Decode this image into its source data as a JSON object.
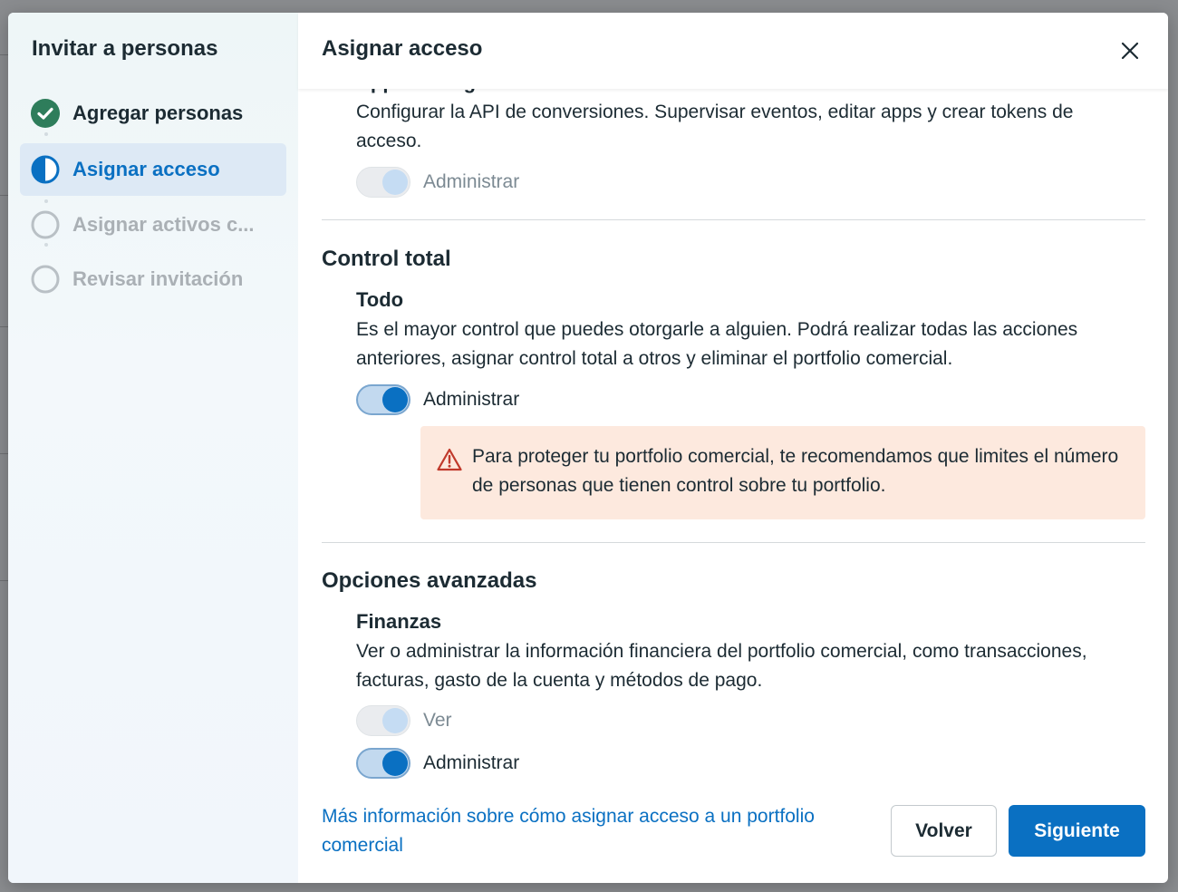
{
  "wizard": {
    "title": "Invitar a personas",
    "steps": [
      {
        "label": "Agregar personas",
        "state": "done"
      },
      {
        "label": "Asignar acceso",
        "state": "current"
      },
      {
        "label": "Asignar activos c...",
        "state": "todo"
      },
      {
        "label": "Revisar invitación",
        "state": "todo"
      }
    ]
  },
  "dialog": {
    "title": "Asignar acceso",
    "close_icon": "close-icon"
  },
  "apps_section": {
    "subtitle_clipped": "Apps e integraciones",
    "description": "Configurar la API de conversiones. Supervisar eventos, editar apps y crear tokens de acceso.",
    "toggles": [
      {
        "label": "Administrar",
        "state": "on-disabled"
      }
    ]
  },
  "full_control": {
    "section_title": "Control total",
    "subtitle": "Todo",
    "description": "Es el mayor control que puedes otorgarle a alguien. Podrá realizar todas las acciones anteriores, asignar control total a otros y eliminar el portfolio comercial.",
    "toggle_label": "Administrar",
    "toggle_state": "on",
    "warning": {
      "icon": "warning-triangle-icon",
      "text": "Para proteger tu portfolio comercial, te recomendamos que limites el número de personas que tienen control sobre tu portfolio."
    }
  },
  "advanced": {
    "section_title": "Opciones avanzadas",
    "subtitle": "Finanzas",
    "description": "Ver o administrar la información financiera del portfolio comercial, como transacciones, facturas, gasto de la cuenta y métodos de pago.",
    "toggles": [
      {
        "label": "Ver",
        "state": "on-disabled"
      },
      {
        "label": "Administrar",
        "state": "on"
      }
    ]
  },
  "footer": {
    "help_link": "Más información sobre cómo asignar acceso a un portfolio comercial",
    "back_label": "Volver",
    "next_label": "Siguiente"
  },
  "colors": {
    "accent": "#0a70c2",
    "success": "#2e7d5b",
    "warning_bg": "#fde9de",
    "warning_icon": "#c0392b"
  }
}
